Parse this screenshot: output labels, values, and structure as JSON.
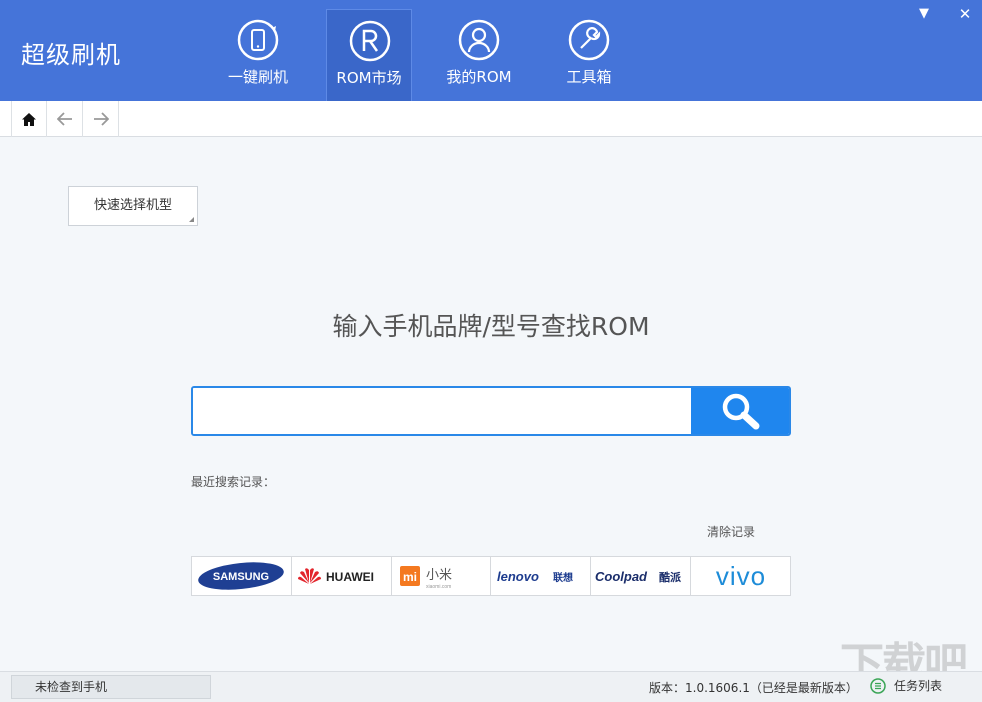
{
  "app": {
    "title": "超级刷机"
  },
  "nav": [
    {
      "label": "一键刷机",
      "icon": "phone-refresh-icon"
    },
    {
      "label": "ROM市场",
      "icon": "rom-r-icon",
      "active": true
    },
    {
      "label": "我的ROM",
      "icon": "user-icon"
    },
    {
      "label": "工具箱",
      "icon": "wrench-icon"
    }
  ],
  "window": {
    "dropdown": "▼",
    "close": "✕"
  },
  "toolbar": {
    "home": "home-icon",
    "back": "arrow-left-icon",
    "forward": "arrow-right-icon"
  },
  "quick_select": {
    "label": "快速选择机型"
  },
  "main": {
    "heading": "输入手机品牌/型号查找ROM"
  },
  "search": {
    "placeholder": "",
    "value": ""
  },
  "recent": {
    "label": "最近搜索记录：",
    "clear": "清除记录"
  },
  "brands": [
    "SAMSUNG",
    "HUAWEI",
    "mi 小米",
    "lenovo联想",
    "Coolpad酷派",
    "vivo"
  ],
  "brand_sub": {
    "xiaomi": "xiaomi.com"
  },
  "status": {
    "device": "未检查到手机",
    "version": "版本：1.0.1606.1（已经是最新版本）",
    "task_list": "任务列表"
  },
  "colors": {
    "header": "#4574d9",
    "search_accent": "#1f86ee"
  }
}
